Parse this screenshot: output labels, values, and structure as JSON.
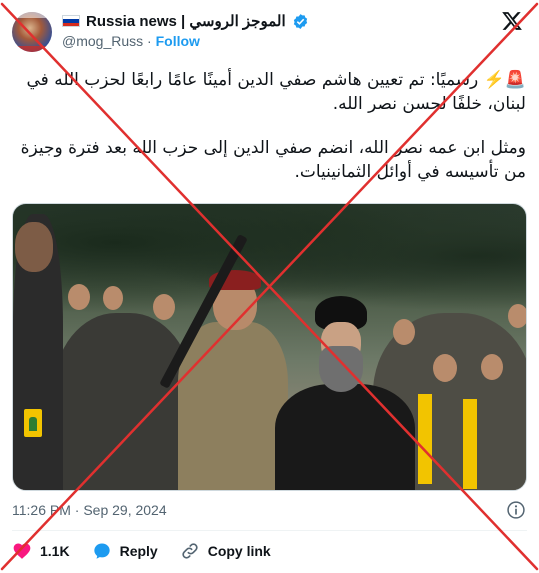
{
  "account": {
    "display_name": "Russia news | الموجز الروسي",
    "handle": "@mog_Russ",
    "separator": "·",
    "follow_label": "Follow"
  },
  "tweet": {
    "paragraph_1": "🚨⚡️ رسميًا: تم تعيين هاشم صفي الدين أمينًا عامًا رابعًا لحزب الله في لبنان، خلفًا لحسن نصر الله.",
    "paragraph_2": "ومثل ابن عمه نصر الله، انضم صفي الدين إلى حزب الله بعد فترة وجيزة من تأسيسه في أوائل الثمانينيات."
  },
  "meta": {
    "timestamp": "11:26 PM · Sep 29, 2024"
  },
  "actions": {
    "like_count": "1.1K",
    "reply_label": "Reply",
    "copy_link_label": "Copy link"
  },
  "colors": {
    "accent": "#1d9bf0",
    "like": "#f91880",
    "overlay_x": "#e0302f",
    "text_secondary": "#536471"
  },
  "icons": [
    "russia-flag-icon",
    "verified-icon",
    "x-logo-icon",
    "info-icon",
    "heart-icon",
    "reply-icon",
    "link-icon"
  ]
}
